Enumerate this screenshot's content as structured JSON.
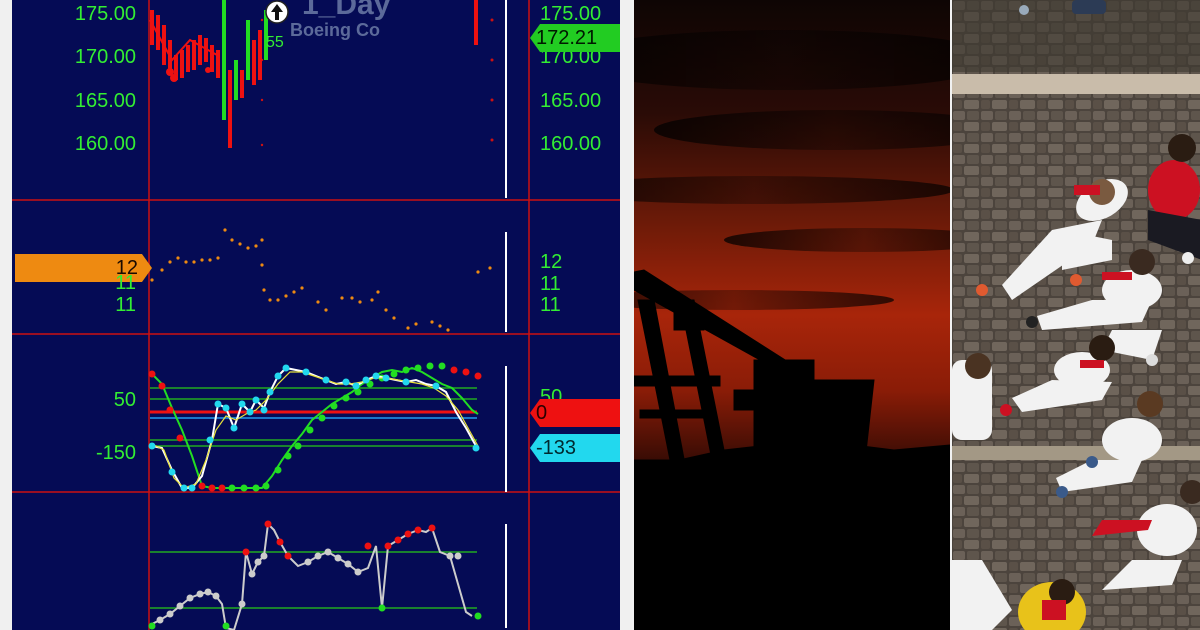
{
  "chart_panel": {
    "symbol_watermark": "1_Day",
    "company_watermark": "Boeing Co",
    "price_marker_label": "55",
    "price_axis_left": [
      "175.00",
      "170.00",
      "165.00",
      "160.00"
    ],
    "price_axis_right": [
      "175.00",
      "170.00",
      "165.00",
      "160.00"
    ],
    "last_price_badge": "172.21",
    "indicator1_axis_right": [
      "12",
      "11",
      "11"
    ],
    "indicator1_axis_left": [
      "12",
      "11",
      "11"
    ],
    "indicator1_badge": "12",
    "oscillator_axis_left": [
      "50",
      "-150"
    ],
    "oscillator_axis_right": [
      "50"
    ],
    "oscillator_zero_badge": "0",
    "oscillator_value_badge": "-133",
    "colors": {
      "background": "#050b55",
      "price_up": "#22dd22",
      "price_down": "#ee1111",
      "axis_text": "#33ee33",
      "badge_green": "#22cc22",
      "badge_orange": "#ee8a11",
      "badge_red": "#ee1111",
      "badge_cyan": "#22d8ee",
      "divider": "#cc1111"
    }
  },
  "sunset_panel": {
    "colors": {
      "sky_top": "#1a0805",
      "sky_glow": "#a8250a",
      "silhouette": "#000000"
    }
  },
  "street_panel": {
    "colors": {
      "cobblestone": "#5a5149",
      "white_clothing": "#f2f2f2",
      "red_accent": "#cc1122",
      "yellow_shirt": "#e8c21a"
    }
  }
}
